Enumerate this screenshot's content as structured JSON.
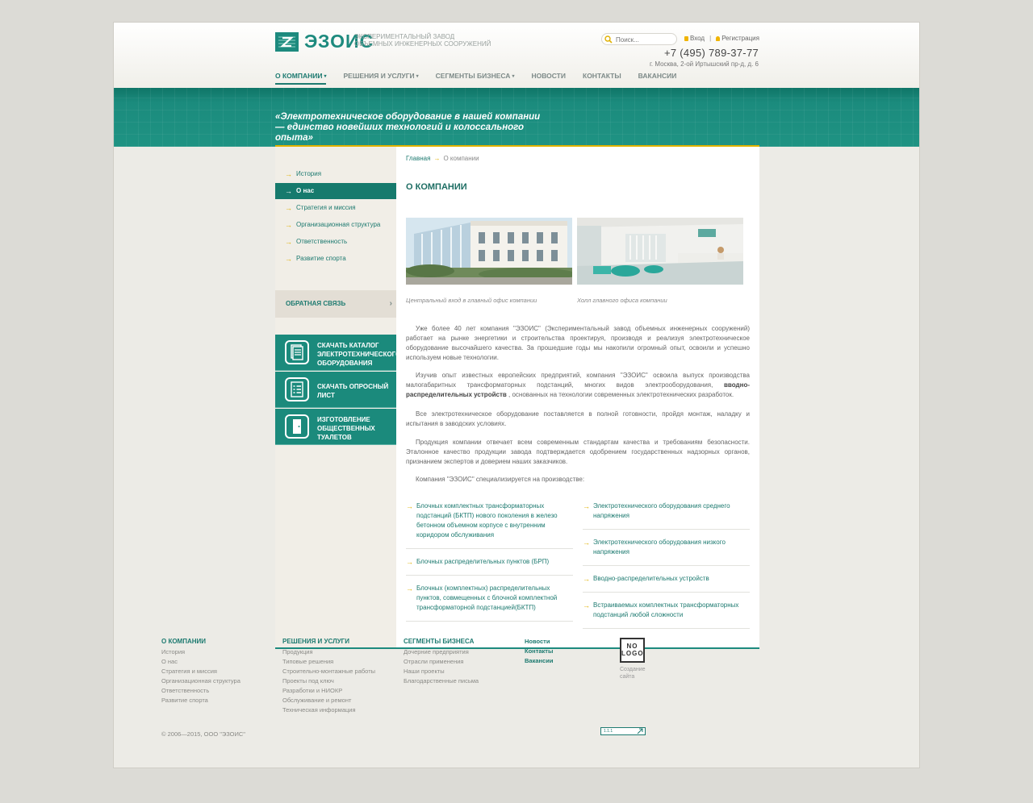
{
  "header": {
    "logo_text": "ЭЗОИС",
    "logo_description": "Экспериментальный завод объемных инженерных сооружений",
    "search_placeholder": "Поиск...",
    "login_label": "Вход",
    "separator": "|",
    "register_label": "Регистрация",
    "phone": "+7 (495) 789-37-77",
    "address": "г. Москва, 2-ой Иртышский пр-д, д. 6"
  },
  "nav": {
    "items": [
      {
        "label": "О компании",
        "dropdown": true,
        "active": true
      },
      {
        "label": "Решения и услуги",
        "dropdown": true
      },
      {
        "label": "Сегменты бизнеса",
        "dropdown": true
      },
      {
        "label": "Новости",
        "dropdown": false
      },
      {
        "label": "Контакты",
        "dropdown": false
      },
      {
        "label": "Вакансии",
        "dropdown": false
      }
    ],
    "caret": "▾"
  },
  "banner": {
    "quote": "«Электротехническое оборудование в нашей компании — единство новейших технологий и колоссального опыта»"
  },
  "sidebar": {
    "arrow": "→",
    "items": [
      {
        "label": "История"
      },
      {
        "label": "О нас",
        "active": true
      },
      {
        "label": "Стратегия и миссия"
      },
      {
        "label": "Организационная структура"
      },
      {
        "label": "Ответственность"
      },
      {
        "label": "Развитие спорта"
      }
    ],
    "feedback_label": "Обратная связь",
    "feedback_arrow": "›",
    "downloads": [
      {
        "label": "Скачать каталог электротехнического оборудования",
        "icon": "catalog-icon"
      },
      {
        "label": "Скачать опросный лист",
        "icon": "questionnaire-icon"
      },
      {
        "label": "Изготовление общественных туалетов",
        "icon": "door-icon"
      }
    ]
  },
  "main": {
    "breadcrumb": {
      "home": "Главная",
      "sep": "→",
      "current": "О компании"
    },
    "title": "О компании",
    "captions": [
      "Центральный вход в главный офис компании",
      "Холл главного офиса компании"
    ],
    "paragraphs": [
      "Уже более 40 лет компания \"ЭЗОИС\" (Экспериментальный завод объемных инженерных сооружений) работает на рынке энергетики и строительства проектируя, производя и реализуя электротехническое оборудование высочайшего качества. За прошедшие годы мы накопили огромный опыт, освоили и успешно используем новые технологии.",
      "Изучив опыт известных европейских предприятий, компания \"ЭЗОИС\" освоила выпуск производства малогабаритных трансформаторных подстанций, многих видов электрооборудования,",
      "вводно-распределительных устройств",
      ", основанных на технологии современных электротехнических разработок.",
      "Все электротехническое оборудование поставляется в полной готовности, пройдя монтаж, наладку и испытания в заводских условиях.",
      "Продукция компании отвечает всем современным стандартам качества и требованиям безопасности. Эталонное качество продукции завода подтверждается одобрением государственных надзорных органов, признанием экспертов и доверием наших заказчиков.",
      "Компания \"ЭЗОИС\" специализируется на производстве:"
    ],
    "products_left": [
      "Блочных комплектных трансформаторных подстанций (БКТП) нового поколения в железо бетонном объемном корпусе с внутренним коридором обслуживания",
      "Блочных распределительных пунктов (БРП)",
      "Блочных (комплектных) распределительных пунктов, совмещенных с блочной комплектной трансформаторной подстанцией(БКТП)"
    ],
    "products_right": [
      "Электротехнического оборудования среднего напряжения",
      "Электротехнического оборудования низкого напряжения",
      "Вводно-распределительных устройств",
      "Встраиваемых комплектных трансформаторных подстанций любой сложности"
    ]
  },
  "footer": {
    "columns": [
      {
        "heading": "О компании",
        "links": [
          "История",
          "О нас",
          "Стратегия и миссия",
          "Организационная структура",
          "Ответственность",
          "Развитие спорта"
        ]
      },
      {
        "heading": "Решения и услуги",
        "links": [
          "Продукция",
          "Типовые решения",
          "Строительно-монтажные работы",
          "Проекты под ключ",
          "Разработки и НИОКР",
          "Обслуживание и ремонт",
          "Техническая информация"
        ]
      },
      {
        "heading": "Сегменты бизнеса",
        "links": [
          "Дочерние предприятия",
          "Отрасли применения",
          "Наши проекты",
          "Благодарственные письма"
        ]
      },
      {
        "heading": "",
        "links": [
          "Новости",
          "Контакты",
          "Вакансии"
        ]
      }
    ],
    "nologo_line1": "NO",
    "nologo_line2": "LOGO",
    "create_site": "Создание сайта",
    "copyright": "© 2006—2015, ООО \"ЭЗОИС\"",
    "counter_text": "1.1.1"
  },
  "colors": {
    "accent": "#1d8a7e",
    "highlight": "#e0b000",
    "background": "#ecebe6"
  }
}
